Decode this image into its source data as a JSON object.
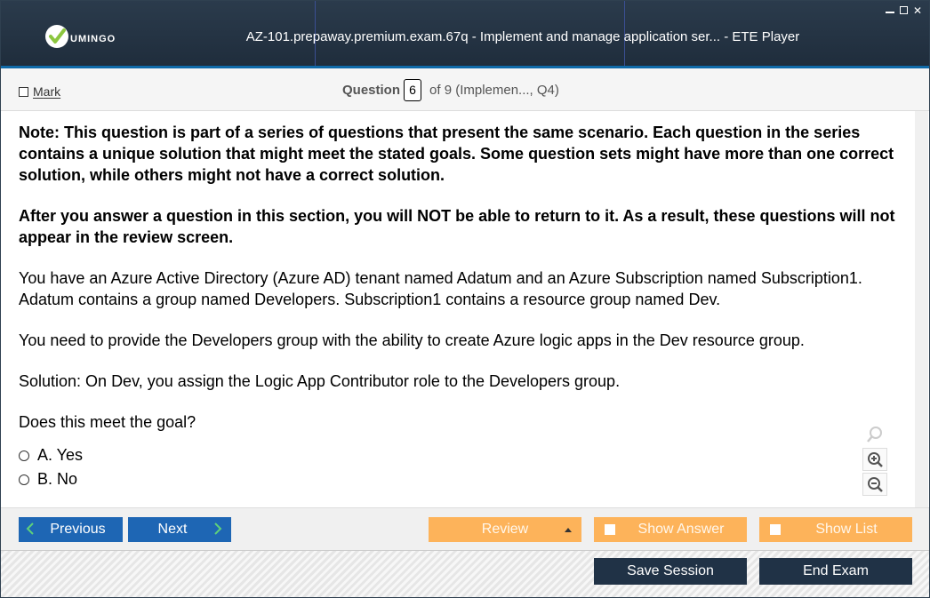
{
  "window": {
    "title": "AZ-101.prepaway.premium.exam.67q - Implement and manage application ser... - ETE Player",
    "logo_text": "UMINGO",
    "controls": [
      "minimize-icon",
      "maximize-icon",
      "close-icon"
    ]
  },
  "header": {
    "mark_label": "Mark",
    "question_label": "Question",
    "question_number": "6",
    "question_of": "of 9 (Implemen..., Q4)"
  },
  "question": {
    "note": "Note: This question is part of a series of questions that present the same scenario. Each question in the series contains a unique solution that might meet the stated goals. Some question sets might have more than one correct solution, while others might not have a correct solution.",
    "warning": "After you answer a question in this section, you will NOT be able to return to it. As a result, these questions will not appear in the review screen.",
    "scenario": "You have an Azure Active Directory (Azure AD) tenant named Adatum and an Azure Subscription named Subscription1. Adatum contains a group named Developers. Subscription1 contains a resource group named Dev.",
    "requirement": "You need to provide the Developers group with the ability to create Azure logic apps in the Dev resource group.",
    "solution": "Solution: On Dev, you assign the Logic App Contributor role to the Developers group.",
    "prompt": "Does this meet the goal?",
    "options": [
      {
        "label": "A. Yes",
        "selected": false
      },
      {
        "label": "B. No",
        "selected": false
      }
    ]
  },
  "zoom": {
    "icons": [
      "search-icon",
      "zoom-in-icon",
      "zoom-out-icon"
    ]
  },
  "nav": {
    "previous_label": "Previous",
    "next_label": "Next",
    "review_label": "Review",
    "show_answer_label": "Show Answer",
    "show_list_label": "Show List",
    "save_session_label": "Save Session",
    "end_exam_label": "End Exam"
  },
  "colors": {
    "titlebar": "#253545",
    "accent_blue": "#1e66b4",
    "accent_orange": "#fdb35a",
    "dark_button": "#203246"
  }
}
